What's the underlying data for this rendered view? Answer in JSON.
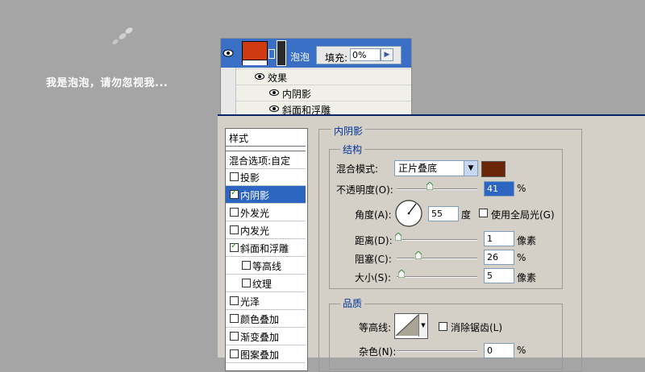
{
  "caption": "我是泡泡，请勿忽视我...",
  "layers": {
    "layer_name": "泡泡",
    "fill_label": "填充:",
    "fill_value": "0%",
    "fx_label": "效果",
    "effects": [
      "内阴影",
      "斜面和浮雕"
    ]
  },
  "styles_list": {
    "header": "样式",
    "blend_options": "混合选项:自定",
    "items": [
      {
        "label": "投影",
        "checked": false,
        "indent": false,
        "active": false
      },
      {
        "label": "内阴影",
        "checked": true,
        "indent": false,
        "active": true
      },
      {
        "label": "外发光",
        "checked": false,
        "indent": false,
        "active": false
      },
      {
        "label": "内发光",
        "checked": false,
        "indent": false,
        "active": false
      },
      {
        "label": "斜面和浮雕",
        "checked": true,
        "indent": false,
        "active": false
      },
      {
        "label": "等高线",
        "checked": false,
        "indent": true,
        "active": false
      },
      {
        "label": "纹理",
        "checked": false,
        "indent": true,
        "active": false
      },
      {
        "label": "光泽",
        "checked": false,
        "indent": false,
        "active": false
      },
      {
        "label": "颜色叠加",
        "checked": false,
        "indent": false,
        "active": false
      },
      {
        "label": "渐变叠加",
        "checked": false,
        "indent": false,
        "active": false
      },
      {
        "label": "图案叠加",
        "checked": false,
        "indent": false,
        "active": false
      }
    ]
  },
  "inner_shadow": {
    "title": "内阴影",
    "structure_title": "结构",
    "blend_mode_label": "混合模式:",
    "blend_mode_value": "正片叠底",
    "shadow_color": "#6b2508",
    "opacity_label": "不透明度(O):",
    "opacity_value": "41",
    "opacity_unit": "%",
    "angle_label": "角度(A):",
    "angle_value": "55",
    "angle_unit": "度",
    "global_light_label": "使用全局光(G)",
    "distance_label": "距离(D):",
    "distance_value": "1",
    "distance_unit": "像素",
    "choke_label": "阻塞(C):",
    "choke_value": "26",
    "choke_unit": "%",
    "size_label": "大小(S):",
    "size_value": "5",
    "size_unit": "像素",
    "quality_title": "品质",
    "contour_label": "等高线:",
    "antialias_label": "消除锯齿(L)",
    "noise_label": "杂色(N):",
    "noise_value": "0",
    "noise_unit": "%"
  },
  "colors": {
    "layer_thumb": "#d03a10",
    "selection": "#2d65c2",
    "title_text": "#003399"
  }
}
